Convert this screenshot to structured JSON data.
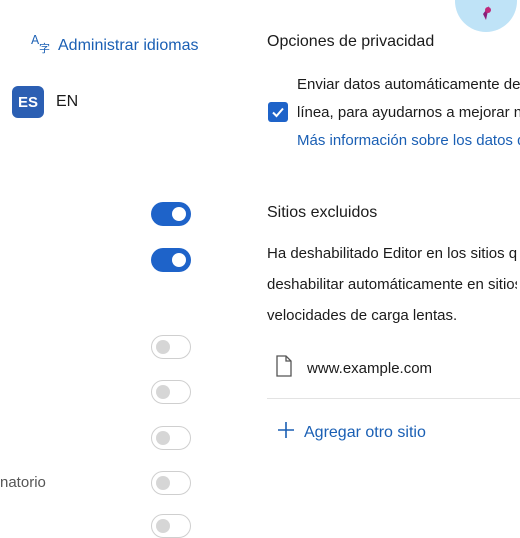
{
  "languages": {
    "manage_label": "Administrar idiomas",
    "badge": "ES",
    "code": "EN"
  },
  "toggles": [
    {
      "state": "on"
    },
    {
      "state": "on"
    },
    {
      "state": "off"
    },
    {
      "state": "off"
    },
    {
      "state": "off"
    },
    {
      "state": "off"
    }
  ],
  "cut_label": "natorio",
  "privacy": {
    "title": "Opciones de privacidad",
    "line1": "Enviar datos automáticamente de di",
    "line2": "línea, para ayudarnos a mejorar nue",
    "link": "Más información sobre los datos d",
    "checked": true
  },
  "excluded": {
    "title": "Sitios excluidos",
    "line1": "Ha deshabilitado Editor en los sitios que",
    "line2": "deshabilitar automáticamente en sitios a",
    "line3": "velocidades de carga lentas.",
    "sites": [
      "www.example.com"
    ],
    "add_label": "Agregar otro sitio"
  },
  "colors": {
    "accent": "#1e63c9",
    "link": "#1a5fb4",
    "badge": "#2b5fb3"
  }
}
